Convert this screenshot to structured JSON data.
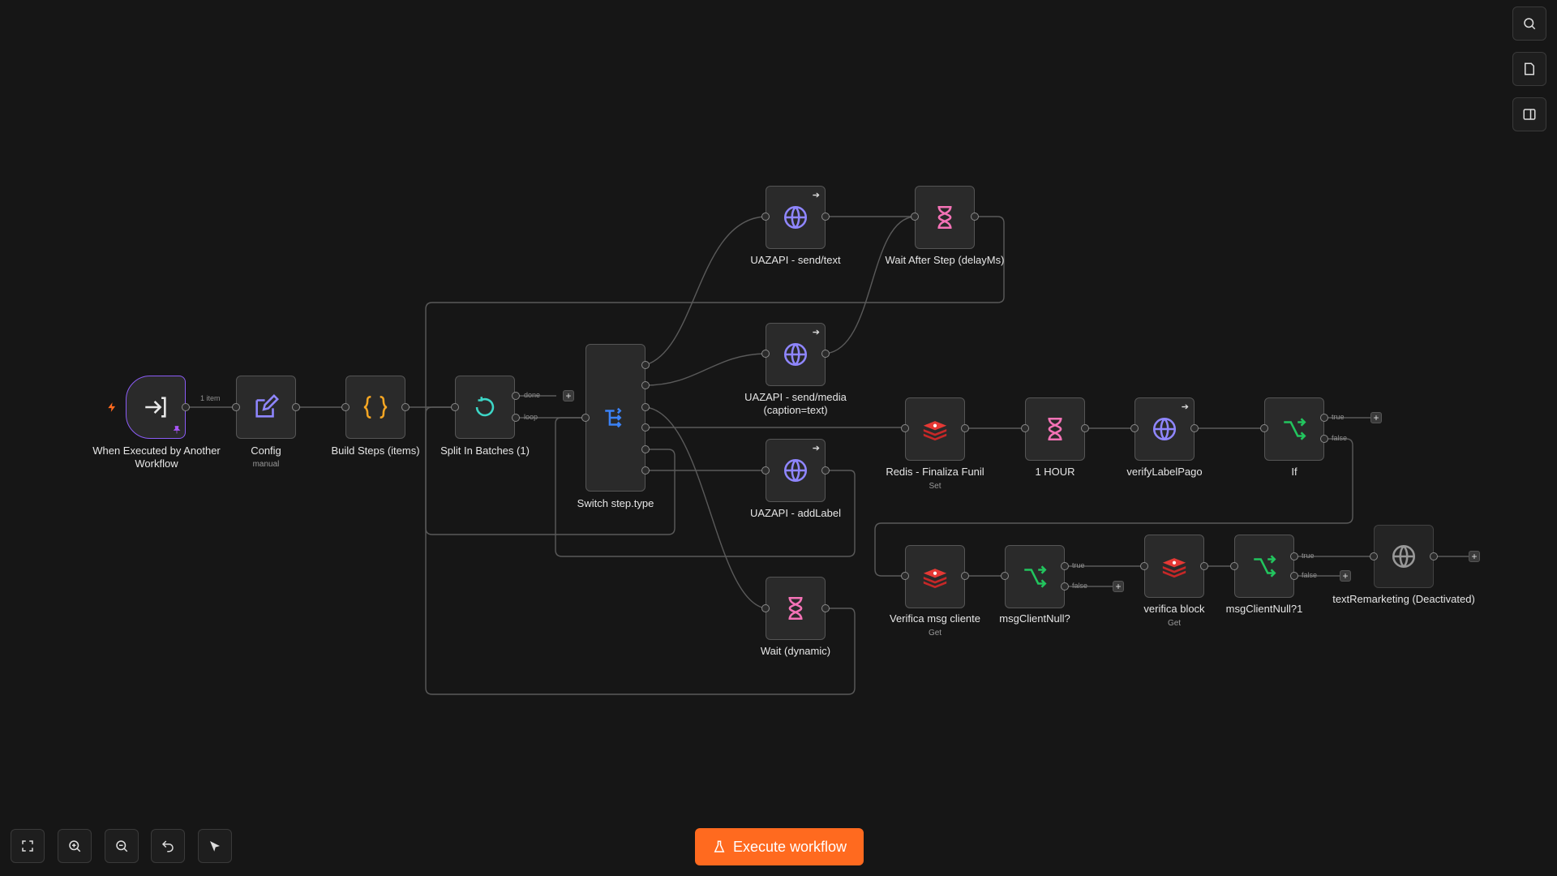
{
  "colors": {
    "background": "#161616",
    "node": "#2a2a2a",
    "accent": "#ff6a1f",
    "trigger_border": "#8b5cf6"
  },
  "nodes": {
    "trigger": {
      "label": "When Executed by Another Workflow",
      "icon": "sign-in-icon"
    },
    "config": {
      "label": "Config",
      "sub": "manual",
      "icon": "pencil-square-icon"
    },
    "build": {
      "label": "Build Steps (items)",
      "icon": "braces-icon"
    },
    "split": {
      "label": "Split In Batches (1)",
      "icon": "loop-icon"
    },
    "switch": {
      "label": "Switch step.type",
      "icon": "switch-icon"
    },
    "sendtext": {
      "label": "UAZAPI - send/text",
      "icon": "globe-icon"
    },
    "waitafter": {
      "label": "Wait After Step (delayMs)",
      "icon": "hourglass-icon"
    },
    "sendmedia": {
      "label": "UAZAPI - send/media (caption=text)",
      "icon": "globe-icon"
    },
    "addlabel": {
      "label": "UAZAPI - addLabel",
      "icon": "globe-icon"
    },
    "waitdyn": {
      "label": "Wait (dynamic)",
      "icon": "hourglass-icon"
    },
    "redisfin": {
      "label": "Redis - Finaliza Funil",
      "sub": "Set",
      "icon": "redis-icon"
    },
    "hour": {
      "label": "1 HOUR",
      "icon": "hourglass-icon"
    },
    "verify": {
      "label": "verifyLabelPago",
      "icon": "globe-icon"
    },
    "if": {
      "label": "If",
      "icon": "if-icon"
    },
    "vmsg": {
      "label": "Verifica msg cliente",
      "sub": "Get",
      "icon": "redis-icon"
    },
    "mcn": {
      "label": "msgClientNull?",
      "icon": "if-icon"
    },
    "vblock": {
      "label": "verifica block",
      "sub": "Get",
      "icon": "redis-icon"
    },
    "mcn1": {
      "label": "msgClientNull?1",
      "icon": "if-icon"
    },
    "remk": {
      "label": "textRemarketing (Deactivated)",
      "icon": "globe-icon"
    }
  },
  "edge_labels": {
    "item_count": "1 item",
    "done": "done",
    "loop": "loop",
    "true": "true",
    "false": "false"
  },
  "toolbar": {
    "execute_label": "Execute workflow",
    "right": [
      "search-icon",
      "sticky-note-icon",
      "panel-icon"
    ],
    "bottom": [
      "fit-view-icon",
      "zoom-in-icon",
      "zoom-out-icon",
      "undo-icon",
      "tidy-up-icon"
    ]
  }
}
